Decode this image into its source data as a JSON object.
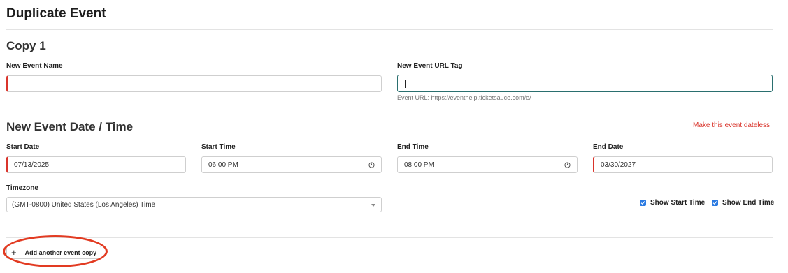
{
  "page": {
    "title": "Duplicate Event"
  },
  "copy": {
    "title": "Copy 1",
    "event_name": {
      "label": "New Event Name",
      "value": ""
    },
    "url_tag": {
      "label": "New Event URL Tag",
      "value": "",
      "helper": "Event URL: https://eventhelp.ticketsauce.com/e/"
    },
    "datetime": {
      "title": "New Event Date / Time",
      "dateless_link": "Make this event dateless",
      "start_date": {
        "label": "Start Date",
        "value": "07/13/2025"
      },
      "start_time": {
        "label": "Start Time",
        "value": "06:00 PM"
      },
      "end_time": {
        "label": "End Time",
        "value": "08:00 PM"
      },
      "end_date": {
        "label": "End Date",
        "value": "03/30/2027"
      },
      "timezone": {
        "label": "Timezone",
        "value": "(GMT-0800) United States (Los Angeles) Time"
      },
      "show_start_time": {
        "label": "Show Start Time",
        "checked": true
      },
      "show_end_time": {
        "label": "Show End Time",
        "checked": true
      }
    }
  },
  "actions": {
    "add_copy": "Add another event copy"
  },
  "colors": {
    "required": "#d9342b",
    "focus": "#2a6f6f",
    "checkbox": "#2a7ae2",
    "highlight": "#e23b22"
  },
  "icons": {
    "time": "clock-icon",
    "add": "plus-icon",
    "dropdown": "chevron-down-icon",
    "check": "check-icon"
  }
}
